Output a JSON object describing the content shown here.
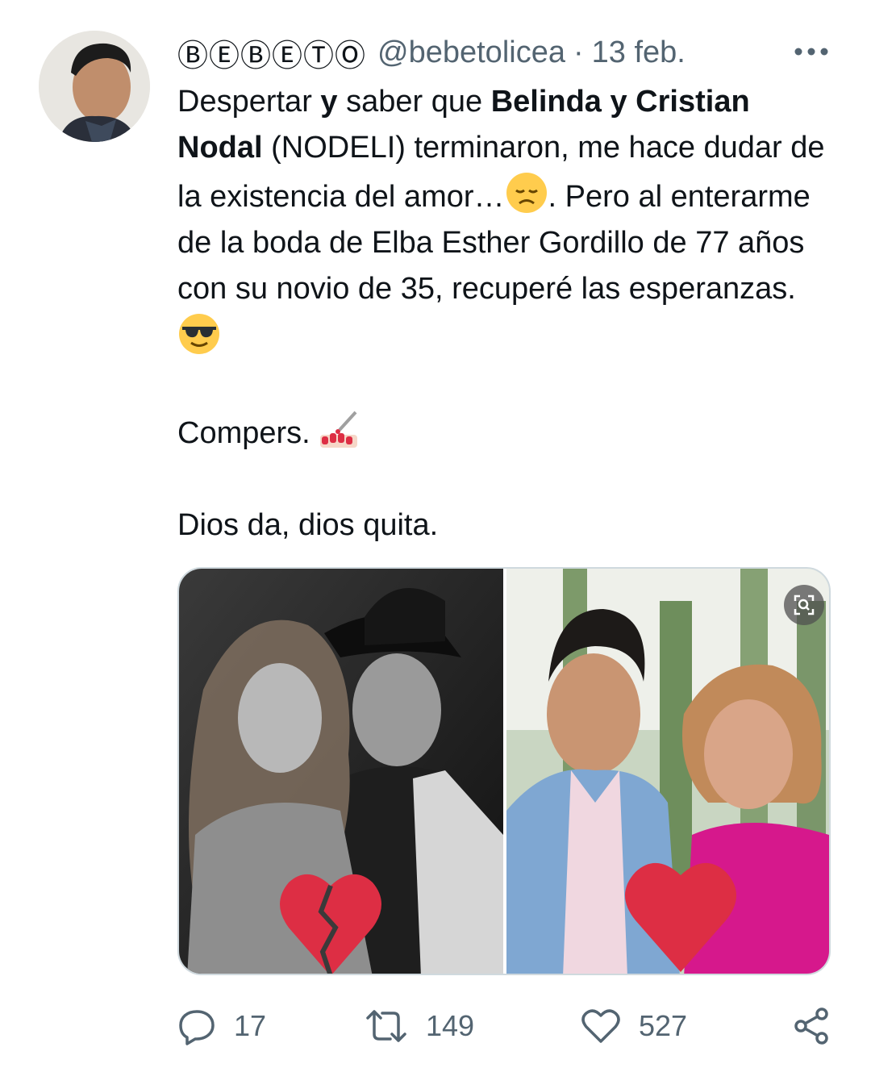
{
  "tweet": {
    "display_name": "ⒷⒺⒷⒺⓉⓄ",
    "handle": "@bebetolicea",
    "separator": "·",
    "date": "13 feb.",
    "more_icon": "more-horizontal-icon",
    "text": {
      "p1_a": "Despertar ",
      "p1_b_bold": "y",
      "p1_c": " saber que ",
      "p1_d_bold": "Belinda y Cristian Nodal",
      "p1_e": " (NODELI) terminaron, me hace dudar de la existencia del amor…",
      "p1_f": ". Pero al enterarme de la boda de Elba Esther Gordillo de 77 años con su novio de 35, recuperé las esperanzas. ",
      "p2": "Compers. ",
      "p3": "Dios da, dios quita."
    },
    "emojis": [
      "disappointed-face-emoji",
      "sunglasses-face-emoji",
      "nail-polish-emoji"
    ]
  },
  "media": {
    "left_panel_icon": "broken-heart-emoji",
    "right_panel_icon": "red-heart-emoji",
    "alt_button_icon": "focus-scan-icon"
  },
  "actions": {
    "reply": {
      "icon": "reply-icon",
      "count": "17"
    },
    "retweet": {
      "icon": "retweet-icon",
      "count": "149"
    },
    "like": {
      "icon": "heart-outline-icon",
      "count": "527"
    },
    "share": {
      "icon": "share-icon",
      "count": ""
    }
  },
  "colors": {
    "text": "#0f1419",
    "muted": "#536471",
    "border": "#cfd9de"
  }
}
